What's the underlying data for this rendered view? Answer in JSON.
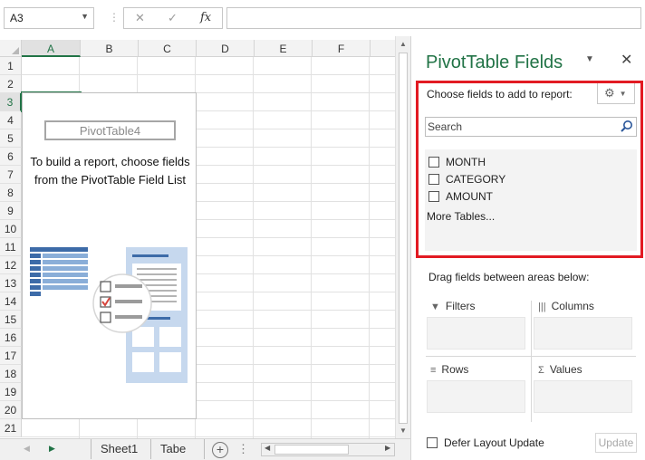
{
  "formula_bar": {
    "name_box": "A3",
    "cancel_icon": "✕",
    "enter_icon": "✓",
    "function_label": "fx",
    "formula": ""
  },
  "grid": {
    "columns": [
      "A",
      "B",
      "C",
      "D",
      "E",
      "F"
    ],
    "rows": [
      "1",
      "2",
      "3",
      "4",
      "5",
      "6",
      "7",
      "8",
      "9",
      "10",
      "11",
      "12",
      "13",
      "14",
      "15",
      "16",
      "17",
      "18",
      "19",
      "20",
      "21"
    ],
    "active_column": "A",
    "active_row": "3"
  },
  "pivot_placeholder": {
    "name": "PivotTable4",
    "message": "To build a report, choose fields from the PivotTable Field List"
  },
  "sheet_tabs": {
    "tabs": [
      "Sheet1",
      "Tabe"
    ],
    "add_label": "+",
    "ellipsis": "⋮"
  },
  "pane": {
    "title": "PivotTable Fields",
    "choose_label": "Choose fields to add to report:",
    "search_placeholder": "Search",
    "fields": [
      {
        "label": "MONTH",
        "checked": false
      },
      {
        "label": "CATEGORY",
        "checked": false
      },
      {
        "label": "AMOUNT",
        "checked": false
      }
    ],
    "more_tables": "More Tables...",
    "drag_label": "Drag fields between areas below:",
    "areas": {
      "filters": "Filters",
      "columns": "Columns",
      "rows": "Rows",
      "values": "Values"
    },
    "defer_label": "Defer Layout Update",
    "update_button": "Update"
  },
  "colors": {
    "accent": "#217346",
    "highlight": "#e21b23",
    "illustration_blue": "#3d6ba8",
    "illustration_light": "#c6d8ee"
  }
}
